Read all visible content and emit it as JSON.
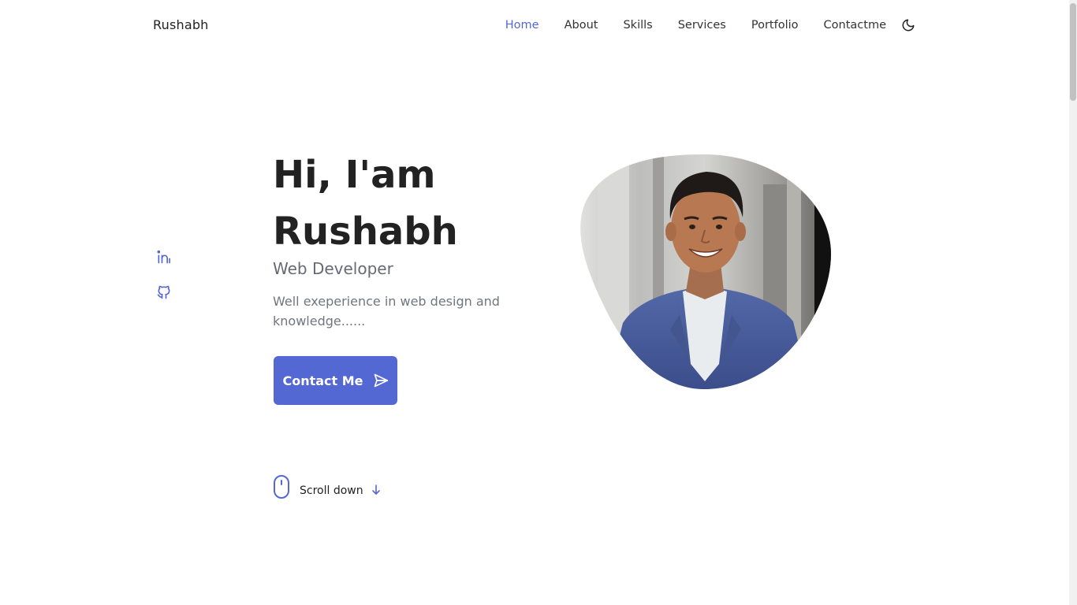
{
  "header": {
    "logo": "Rushabh",
    "nav": [
      {
        "label": "Home",
        "active": true
      },
      {
        "label": "About",
        "active": false
      },
      {
        "label": "Skills",
        "active": false
      },
      {
        "label": "Services",
        "active": false
      },
      {
        "label": "Portfolio",
        "active": false
      },
      {
        "label": "Contactme",
        "active": false
      }
    ],
    "theme_icon": "moon-icon"
  },
  "social": {
    "icons": [
      "linkedin-icon",
      "github-icon"
    ]
  },
  "hero": {
    "title_line1": "Hi, I'am",
    "title_line2": "Rushabh",
    "subtitle": "Web Developer",
    "description": "Well exeperience in web design and knowledge......",
    "button_label": "Contact Me",
    "button_icon": "send-icon"
  },
  "scroll": {
    "label": "Scroll down",
    "icons": [
      "mouse-icon",
      "arrow-down-icon"
    ]
  },
  "colors": {
    "accent": "#5468d4",
    "title": "#222222",
    "text_muted": "#72757f"
  }
}
